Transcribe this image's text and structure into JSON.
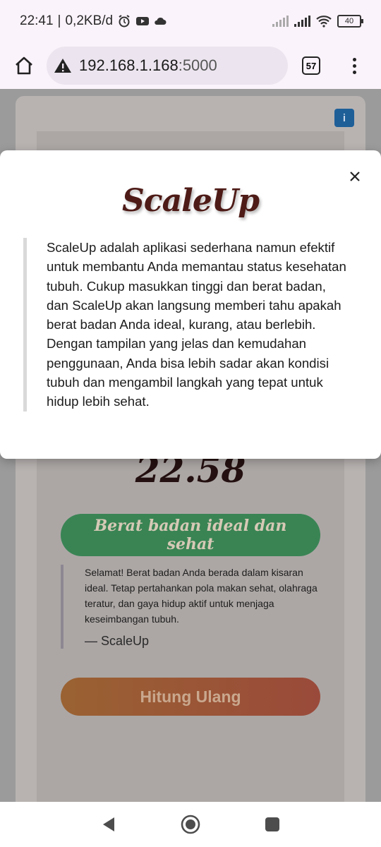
{
  "status_bar": {
    "time": "22:41",
    "net_speed": "0,2KB/d",
    "battery": "40"
  },
  "browser": {
    "url_host": "192.168.1.168",
    "url_port": ":5000",
    "tab_count": "57"
  },
  "page": {
    "bmi_value": "22.58",
    "status_label": "Berat badan ideal dan sehat",
    "message": "Selamat! Berat badan Anda berada dalam kisaran ideal. Tetap pertahankan pola makan sehat, olahraga teratur, dan gaya hidup aktif untuk menjaga keseimbangan tubuh.",
    "author": "— ScaleUp",
    "recalc_label": "Hitung Ulang",
    "info_label": "i"
  },
  "modal": {
    "title": "ScaleUp",
    "description": "ScaleUp adalah aplikasi sederhana namun efektif untuk membantu Anda memantau status kesehatan tubuh. Cukup masukkan tinggi dan berat badan, dan ScaleUp akan langsung memberi tahu apakah berat badan Anda ideal, kurang, atau berlebih. Dengan tampilan yang jelas dan kemudahan penggunaan, Anda bisa lebih sadar akan kondisi tubuh dan mengambil langkah yang tepat untuk hidup lebih sehat.",
    "close_icon": "close-icon"
  },
  "colors": {
    "brand": "#4e1b17",
    "status_green": "#3a8454",
    "info_blue": "#1e5f98"
  }
}
